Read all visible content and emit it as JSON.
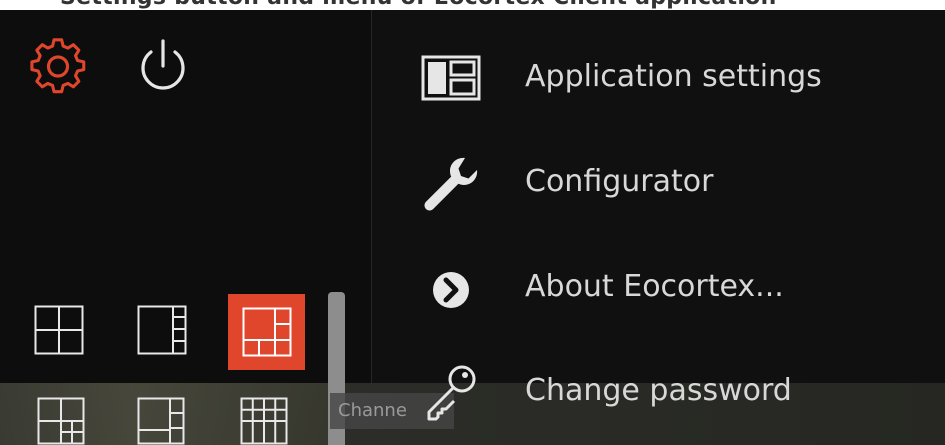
{
  "header_fragment": "Settings button and menu of Eocortex Client application",
  "top_toolbar": {
    "settings_icon": "gear-icon",
    "power_icon": "power-icon",
    "accent_color": "#e0462c"
  },
  "layouts": {
    "items": [
      {
        "name": "layout-2x2",
        "active": false
      },
      {
        "name": "layout-1plus3",
        "active": false
      },
      {
        "name": "layout-1plus7",
        "active": true
      },
      {
        "name": "layout-1plus8",
        "active": false
      },
      {
        "name": "layout-1plus5",
        "active": false
      },
      {
        "name": "layout-4x4",
        "active": false
      }
    ]
  },
  "channel_label": "Channe",
  "menu": {
    "items": [
      {
        "label": "Application settings",
        "icon": "panel-layout-icon"
      },
      {
        "label": "Configurator",
        "icon": "wrench-icon"
      },
      {
        "label": "About Eocortex...",
        "icon": "chevron-circle-icon"
      },
      {
        "label": "Change password",
        "icon": "key-icon"
      }
    ]
  }
}
